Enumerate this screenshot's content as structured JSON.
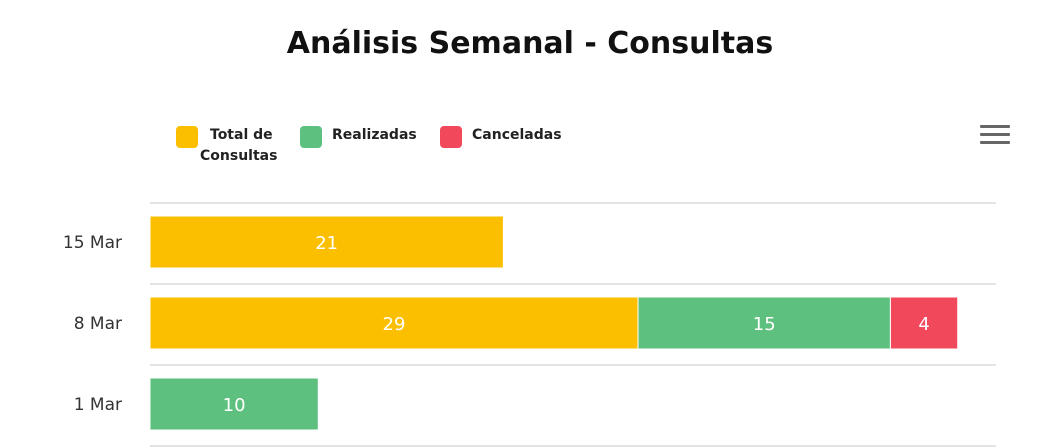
{
  "chart_data": {
    "type": "bar",
    "orientation": "horizontal",
    "stacked": true,
    "title": "Análisis Semanal - Consultas",
    "categories": [
      "15 Mar",
      "8 Mar",
      "1 Mar"
    ],
    "series": [
      {
        "name": "Total de Consultas",
        "color": "#fbbf00",
        "values": [
          21,
          29,
          null
        ]
      },
      {
        "name": "Realizadas",
        "color": "#5ec07e",
        "values": [
          null,
          15,
          10
        ]
      },
      {
        "name": "Canceladas",
        "color": "#f2485b",
        "values": [
          null,
          4,
          null
        ]
      }
    ],
    "data_labels": true,
    "grid": true,
    "legend_position": "top-left"
  },
  "legend": {
    "total_line1": "Total de",
    "total_line2": "Consultas",
    "realizadas": "Realizadas",
    "canceladas": "Canceladas"
  },
  "toolbar": {
    "menu_icon": "hamburger-menu-icon"
  }
}
